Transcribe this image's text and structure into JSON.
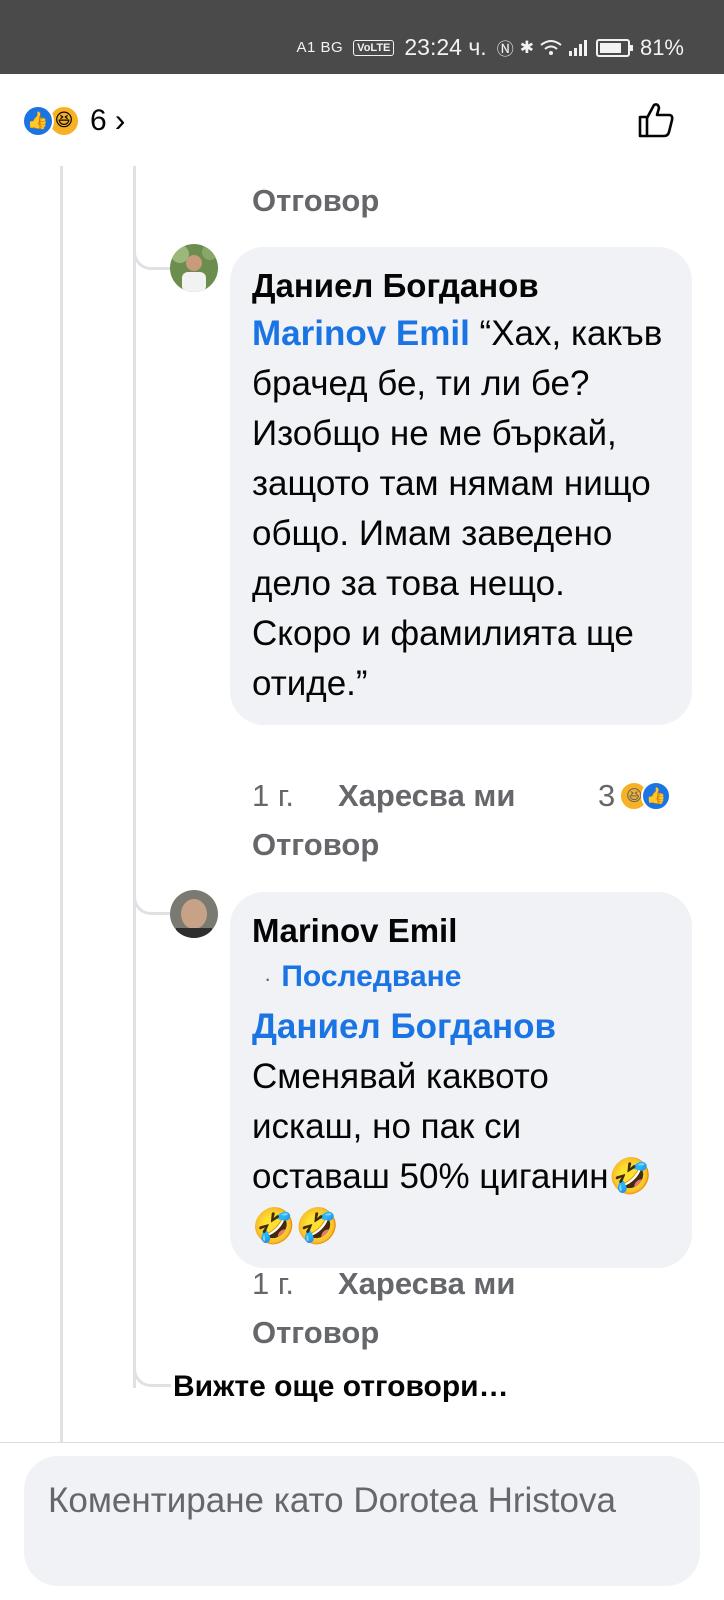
{
  "status_bar": {
    "carrier": "A1 BG",
    "network_badge": "VoLTE",
    "time": "23:24 ч.",
    "battery": "81%",
    "battery_level": 0.81
  },
  "post_reactions": {
    "count": "6",
    "icons": [
      "like-icon",
      "haha-icon"
    ]
  },
  "thread": {
    "prev_reply_label": "Отговор",
    "comments": [
      {
        "author": "Даниел Богданов",
        "mention": "Marinov Emil",
        "text": " “Хах, какъв брачед бе, ти ли бе? Изобщо не ме бъркай, защото там нямам нищо общо. Имам заведено дело за това нещо. Скоро и фамилията ще отиде.”",
        "time": "1 г.",
        "like_label": "Харесва ми",
        "reply_label": "Отговор",
        "reaction_count": "3",
        "reaction_icons": [
          "haha-icon",
          "like-icon"
        ]
      },
      {
        "author": "Marinov Emil",
        "follow_label": "Последване",
        "mention": "Даниел Богданов",
        "text": "Сменявай каквото искаш, но пак си оставаш 50% циганин🤣🤣🤣",
        "time": "1 г.",
        "like_label": "Харесва ми",
        "reply_label": "Отговор"
      }
    ],
    "more_replies": "Вижте още отговори…"
  },
  "composer": {
    "placeholder": "Коментиране като Dorotea Hristova"
  },
  "colors": {
    "accent": "#1b74e4",
    "bubble": "#f0f2f5",
    "secondary_text": "#65676b",
    "status_bar": "#4a4a4a"
  }
}
